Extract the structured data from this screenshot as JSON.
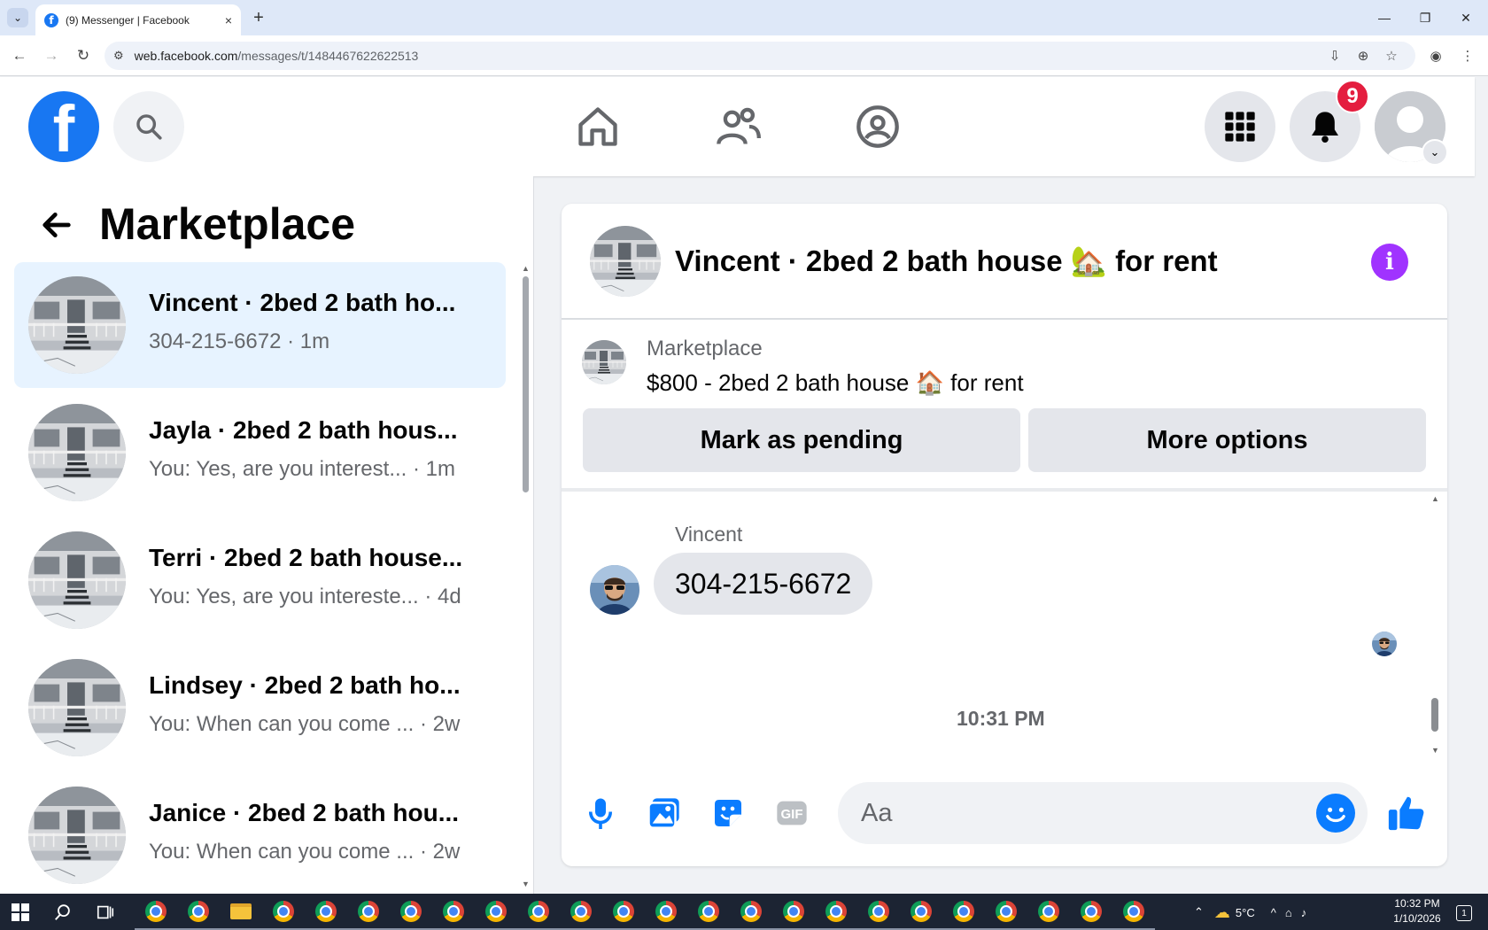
{
  "browser": {
    "tab_title": "(9) Messenger | Facebook",
    "tab_close": "×",
    "new_tab": "+",
    "url_host": "web.facebook.com",
    "url_path": "/messages/t/1484467622622513"
  },
  "header": {
    "logo_letter": "f",
    "notification_count": "9"
  },
  "sidebar": {
    "title": "Marketplace",
    "conversations": [
      {
        "name": "Vincent · 2bed 2 bath ho...",
        "snippet": "304-215-6672 · 1m",
        "active": true
      },
      {
        "name": "Jayla · 2bed 2 bath hous...",
        "snippet": "You: Yes, are you interest...  · 1m",
        "active": false
      },
      {
        "name": "Terri · 2bed 2 bath house...",
        "snippet": "You: Yes, are you intereste... · 4d",
        "active": false
      },
      {
        "name": "Lindsey · 2bed 2 bath ho...",
        "snippet": "You: When can you come ... · 2w",
        "active": false
      },
      {
        "name": "Janice · 2bed 2 bath hou...",
        "snippet": "You: When can you come ... · 2w",
        "active": false
      }
    ]
  },
  "chat": {
    "title": "Vincent · 2bed 2 bath house 🏡 for rent",
    "info_label": "i",
    "marketplace_label": "Marketplace",
    "listing": "$800 - 2bed 2 bath house 🏠 for rent",
    "mark_pending_label": "Mark as pending",
    "more_options_label": "More options",
    "sender_name": "Vincent",
    "message_text": "304-215-6672",
    "timestamp": "10:31 PM",
    "input_placeholder": "Aa",
    "gif_label": "GIF"
  },
  "taskbar": {
    "weather": "5°C",
    "time": "10:32 PM",
    "date": "1/10/2026",
    "notification_count": "1"
  },
  "colors": {
    "facebook_blue": "#1877f2",
    "messenger_blue": "#0a7cff",
    "active_row": "#e7f3ff",
    "badge_red": "#e41e3f",
    "info_purple": "#a033ff"
  }
}
